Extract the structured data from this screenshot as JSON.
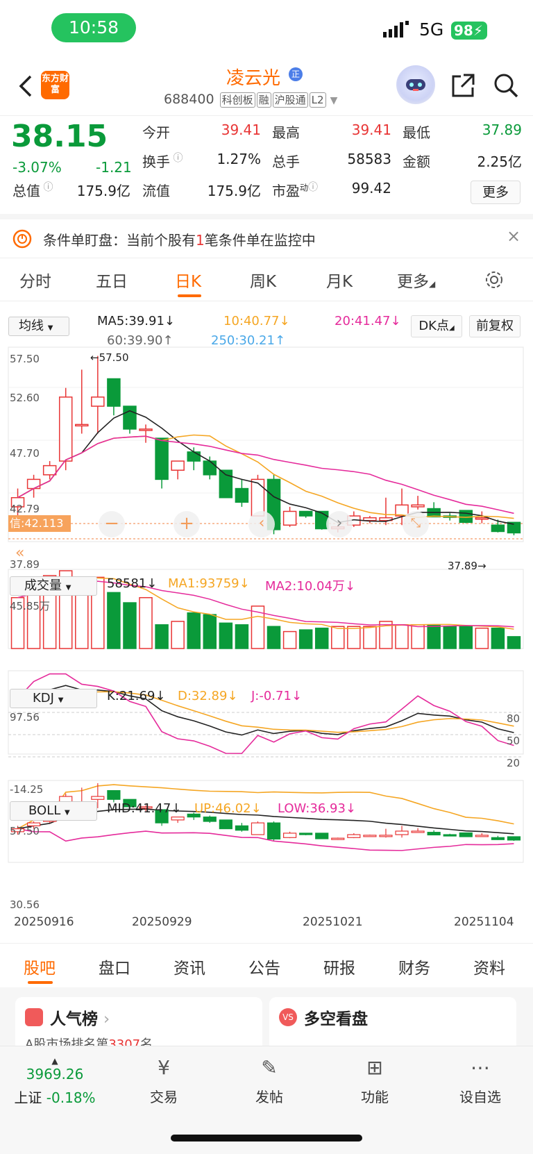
{
  "status": {
    "time": "10:58",
    "network": "5G",
    "battery": "98"
  },
  "header": {
    "title": "凌云光",
    "badge": "正",
    "code": "688400",
    "tags": [
      "科创板",
      "融",
      "沪股通",
      "L2"
    ],
    "logo": "东方财富"
  },
  "quote": {
    "price": "38.15",
    "change_pct": "-3.07%",
    "change": "-1.21",
    "fields": [
      {
        "label": "今开",
        "value": "39.41",
        "color": "up"
      },
      {
        "label": "最高",
        "value": "39.41",
        "color": "up"
      },
      {
        "label": "最低",
        "value": "37.89",
        "color": "dn"
      },
      {
        "label": "换手",
        "value": "1.27%",
        "color": ""
      },
      {
        "label": "总手",
        "value": "58583",
        "color": ""
      },
      {
        "label": "金额",
        "value": "2.25亿",
        "color": ""
      },
      {
        "label": "总值",
        "value": "175.9亿",
        "color": ""
      },
      {
        "label": "流值",
        "value": "175.9亿",
        "color": ""
      },
      {
        "label": "市盈",
        "sup": "动",
        "value": "99.42",
        "color": ""
      }
    ],
    "more": "更多"
  },
  "alert": {
    "text_a": "条件单盯盘：当前个股有",
    "count": "1",
    "text_b": "笔条件单在监控中"
  },
  "tabs": [
    "分时",
    "五日",
    "日K",
    "周K",
    "月K",
    "更多"
  ],
  "chart": {
    "ma_selector": "均线",
    "ma5": "MA5:39.91",
    "ma10": "10:40.77",
    "ma20": "20:41.47",
    "ma60": "60:39.90",
    "ma250": "250:30.21",
    "dk": "DK点",
    "fq": "前复权",
    "price_ticks": [
      "57.50",
      "52.60",
      "47.70",
      "42.79",
      "37.89"
    ],
    "max_label": "57.50",
    "min_label": "37.89",
    "cursor_label": "信:42.113",
    "vol_selector": "成交量",
    "vol": "58581",
    "vol_ma1": "MA1:93759",
    "vol_ma2": "MA2:10.04万",
    "vol_top": "45.85万",
    "kdj_selector": "KDJ",
    "k": "K:21.69",
    "d": "D:32.89",
    "j": "J:-0.71",
    "kdj_top": "97.56",
    "kdj_bottom": "-14.25",
    "kdj_levels": [
      "80",
      "50",
      "20"
    ],
    "boll_selector": "BOLL",
    "mid": "MID:41.47",
    "up": "UP:46.02",
    "low": "LOW:36.93",
    "boll_top": "57.50",
    "boll_bottom": "30.56",
    "dates": [
      "20250916",
      "20250929",
      "20251021",
      "20251104"
    ]
  },
  "chart_data": {
    "type": "candlestick",
    "candles": [
      [
        41,
        43,
        40,
        42
      ],
      [
        43,
        44.5,
        42,
        44
      ],
      [
        44.5,
        46,
        44,
        45.5
      ],
      [
        46,
        54,
        45,
        53
      ],
      [
        50,
        56,
        49,
        50
      ],
      [
        52,
        57.5,
        49,
        53
      ],
      [
        55,
        55,
        51,
        52
      ],
      [
        52,
        52,
        49,
        49.5
      ],
      [
        49.5,
        50,
        48,
        49.5
      ],
      [
        48.5,
        48.5,
        43,
        44
      ],
      [
        45,
        46,
        44,
        46
      ],
      [
        47,
        47.5,
        45,
        46
      ],
      [
        46,
        46.5,
        44,
        44.5
      ],
      [
        45,
        45,
        42,
        42
      ],
      [
        43,
        44,
        41,
        41.5
      ],
      [
        40,
        44.5,
        40,
        44
      ],
      [
        44,
        44.5,
        38,
        38.5
      ],
      [
        39,
        41,
        38.8,
        40.5
      ],
      [
        40.5,
        40.5,
        39.8,
        40
      ],
      [
        40.5,
        40.5,
        38.5,
        38.6
      ],
      [
        38.6,
        39,
        38.2,
        38.8
      ],
      [
        39,
        40.5,
        38.8,
        40
      ],
      [
        39.5,
        40,
        39.2,
        39.8
      ],
      [
        39.5,
        42,
        39,
        39.8
      ],
      [
        40,
        43,
        39,
        41.2
      ],
      [
        41,
        42.2,
        40.7,
        41.2
      ],
      [
        40.8,
        41.5,
        40,
        39.9
      ],
      [
        40,
        40.3,
        39.5,
        39.9
      ],
      [
        40.6,
        40.6,
        39.2,
        39.3
      ],
      [
        39.8,
        40.5,
        39.2,
        39.8
      ],
      [
        39,
        39.6,
        38.2,
        38.3
      ],
      [
        39.3,
        39.3,
        37.89,
        38.15
      ]
    ],
    "volume": [
      30,
      35,
      43,
      45.85,
      42,
      42,
      33,
      27,
      30,
      14,
      16,
      21,
      20,
      15,
      14,
      25,
      13,
      10,
      11,
      12,
      13,
      13,
      13,
      16,
      14,
      14,
      14,
      13,
      13,
      12,
      12,
      7
    ]
  },
  "bottom_tabs": [
    "股吧",
    "盘口",
    "资讯",
    "公告",
    "研报",
    "财务",
    "资料"
  ],
  "cards": [
    {
      "title": "人气榜",
      "sub": "A股市场排名第",
      "rank": "3307",
      "unit": "名"
    },
    {
      "title": "多空看盘"
    }
  ],
  "nav": {
    "index_value": "3969.26",
    "index_name": "上证",
    "index_pct": "-0.18%",
    "items": [
      "交易",
      "发帖",
      "功能",
      "设自选"
    ]
  }
}
